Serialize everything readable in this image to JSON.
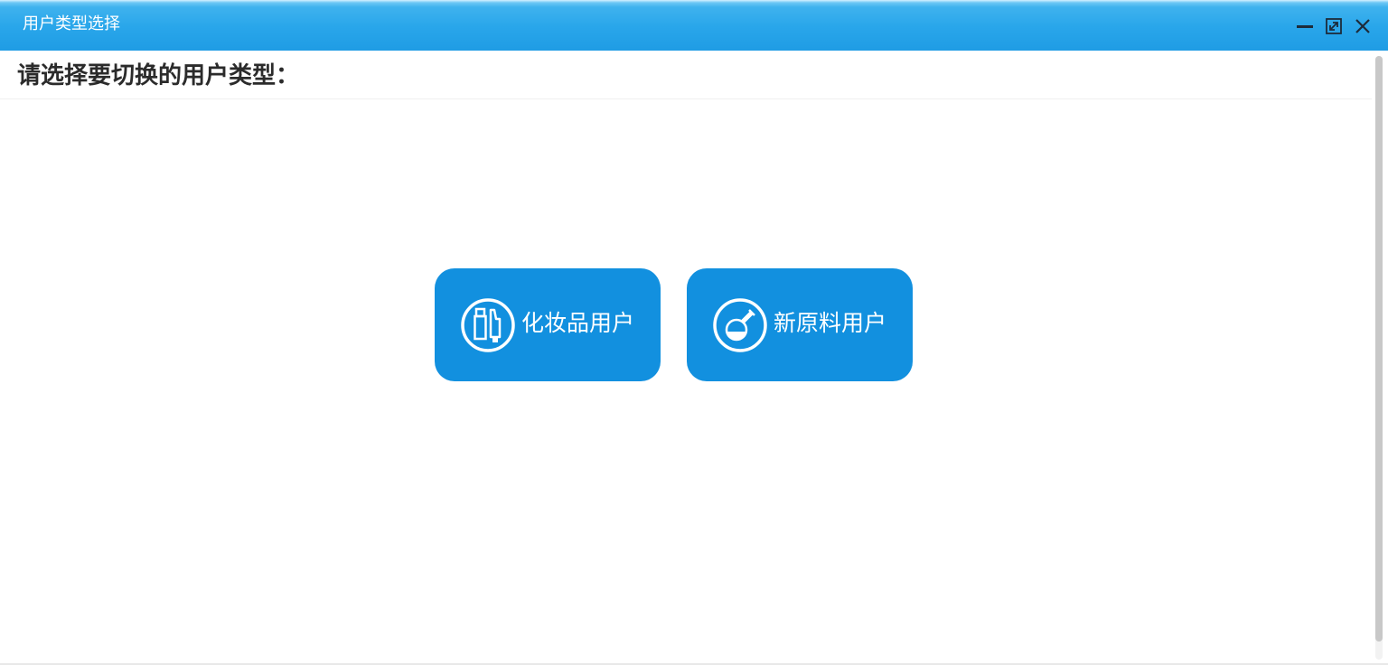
{
  "window": {
    "title": "用户类型选择",
    "controls": {
      "minimize": "minimize-icon",
      "maximize": "maximize-icon",
      "close": "close-icon"
    }
  },
  "main": {
    "prompt": "请选择要切换的用户类型：",
    "options": [
      {
        "label": "化妆品用户",
        "icon": "cosmetics-icon"
      },
      {
        "label": "新原料用户",
        "icon": "flask-icon"
      }
    ]
  },
  "colors": {
    "titlebar": "#29a6ea",
    "button": "#1290df",
    "text_dark": "#2b2b2b",
    "text_light": "#ffffff"
  }
}
